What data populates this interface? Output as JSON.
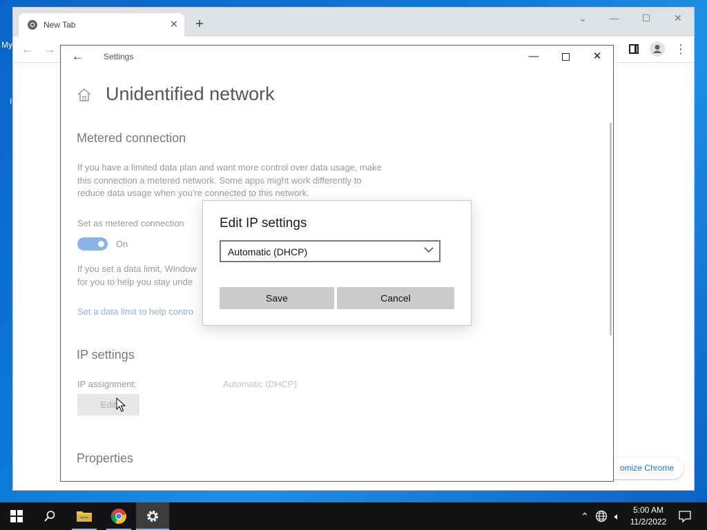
{
  "desktop": {
    "edge_text_1": "My",
    "edge_text_2": "I"
  },
  "chrome": {
    "tab_title": "New Tab",
    "tab_close": "✕",
    "new_tab": "+",
    "customize_label": "omize Chrome"
  },
  "settings": {
    "window_title": "Settings",
    "page_title": "Unidentified network",
    "metered_section": "Metered connection",
    "metered_description": "If you have a limited data plan and want more control over data usage, make this connection a metered network. Some apps might work differently to reduce data usage when you're connected to this network.",
    "set_metered_label": "Set as metered connection",
    "toggle_state": "On",
    "data_limit_description": "If you set a data limit, Window\nfor you to help you stay unde",
    "data_limit_link": "Set a data limit to help contro",
    "ip_section": "IP settings",
    "ip_assignment_label": "IP assignment:",
    "ip_assignment_value": "Automatic (DHCP)",
    "edit_button": "Edit",
    "properties_section": "Properties"
  },
  "dialog": {
    "title": "Edit IP settings",
    "selected_option": "Automatic (DHCP)",
    "save_label": "Save",
    "cancel_label": "Cancel"
  },
  "taskbar": {
    "time": "5:00 AM",
    "date": "11/2/2022"
  },
  "colors": {
    "accent": "#0078d7",
    "toggle_on": "#8ab4e8",
    "link": "#8bb3dc",
    "taskbar_bg": "#111314"
  }
}
